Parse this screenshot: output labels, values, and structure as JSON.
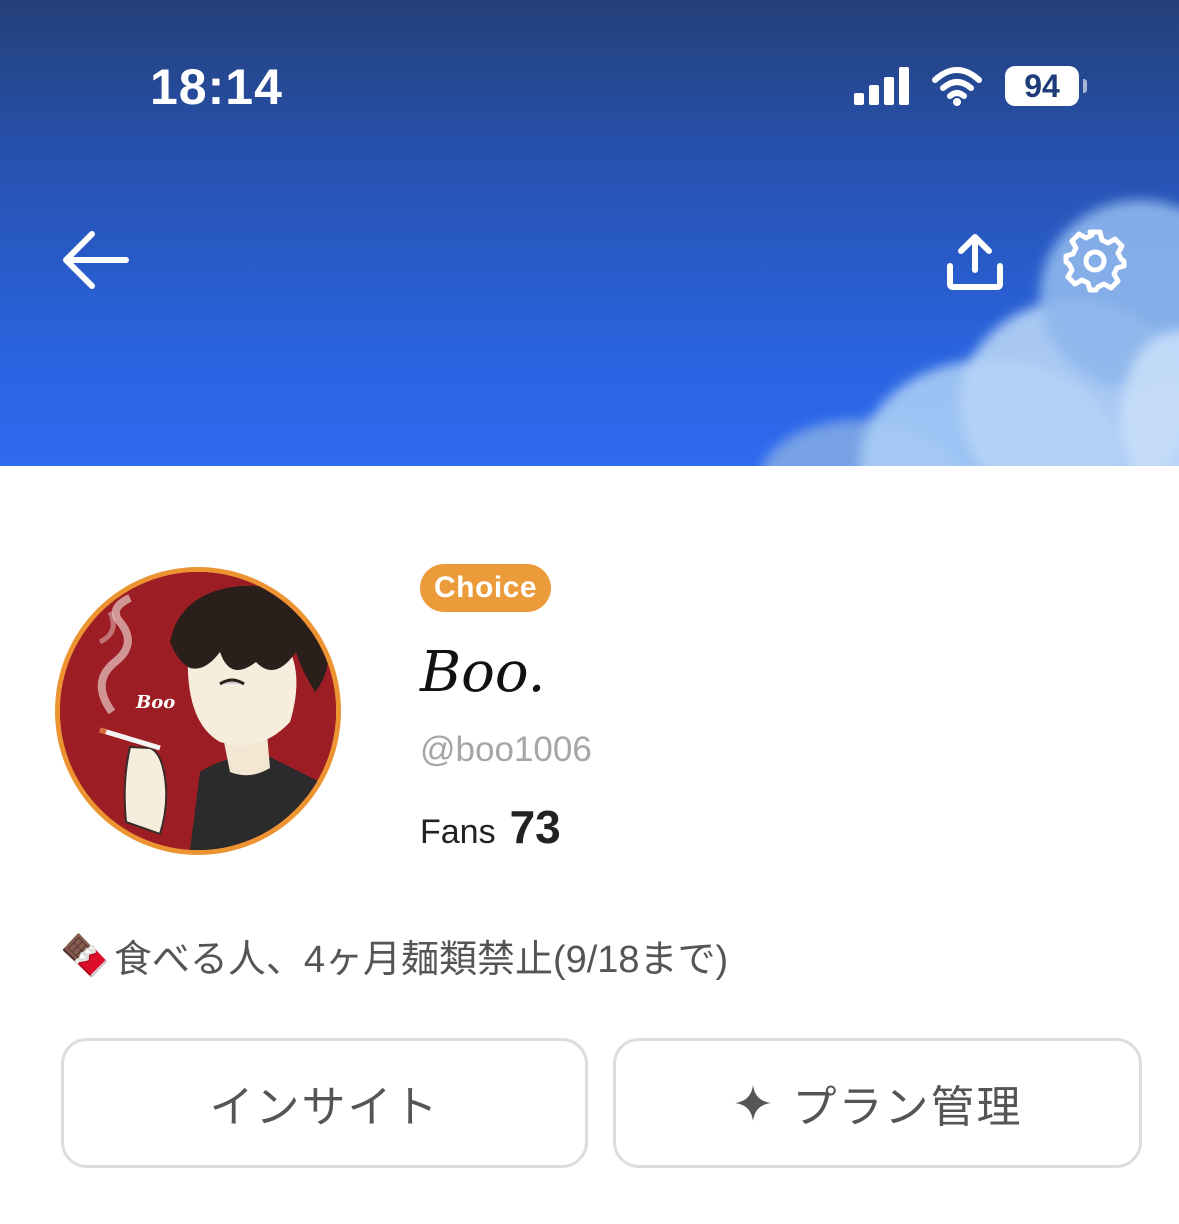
{
  "status_bar": {
    "time": "18:14",
    "battery": "94",
    "icons": [
      "signal-icon",
      "wifi-icon",
      "battery-icon"
    ]
  },
  "header": {
    "back_icon": "arrow-left-icon",
    "share_icon": "share-upload-icon",
    "settings_icon": "gear-icon"
  },
  "profile": {
    "badge": "Choice",
    "name": "Boo.",
    "handle": "@boo1006",
    "fans_label": "Fans",
    "fans_count": "73",
    "avatar_text": "Boo",
    "bio_emoji": "🍫",
    "bio": "食べる人、4ヶ月麺類禁止(9/18まで)"
  },
  "actions": {
    "insight_label": "インサイト",
    "plan_label": "プラン管理",
    "plan_icon": "sparkle-icon"
  },
  "colors": {
    "header_top": "#244079",
    "header_bottom": "#2f6af0",
    "badge": "#ec9b3b",
    "avatar_border": "#ec9432",
    "avatar_bg": "#9c1e24"
  }
}
